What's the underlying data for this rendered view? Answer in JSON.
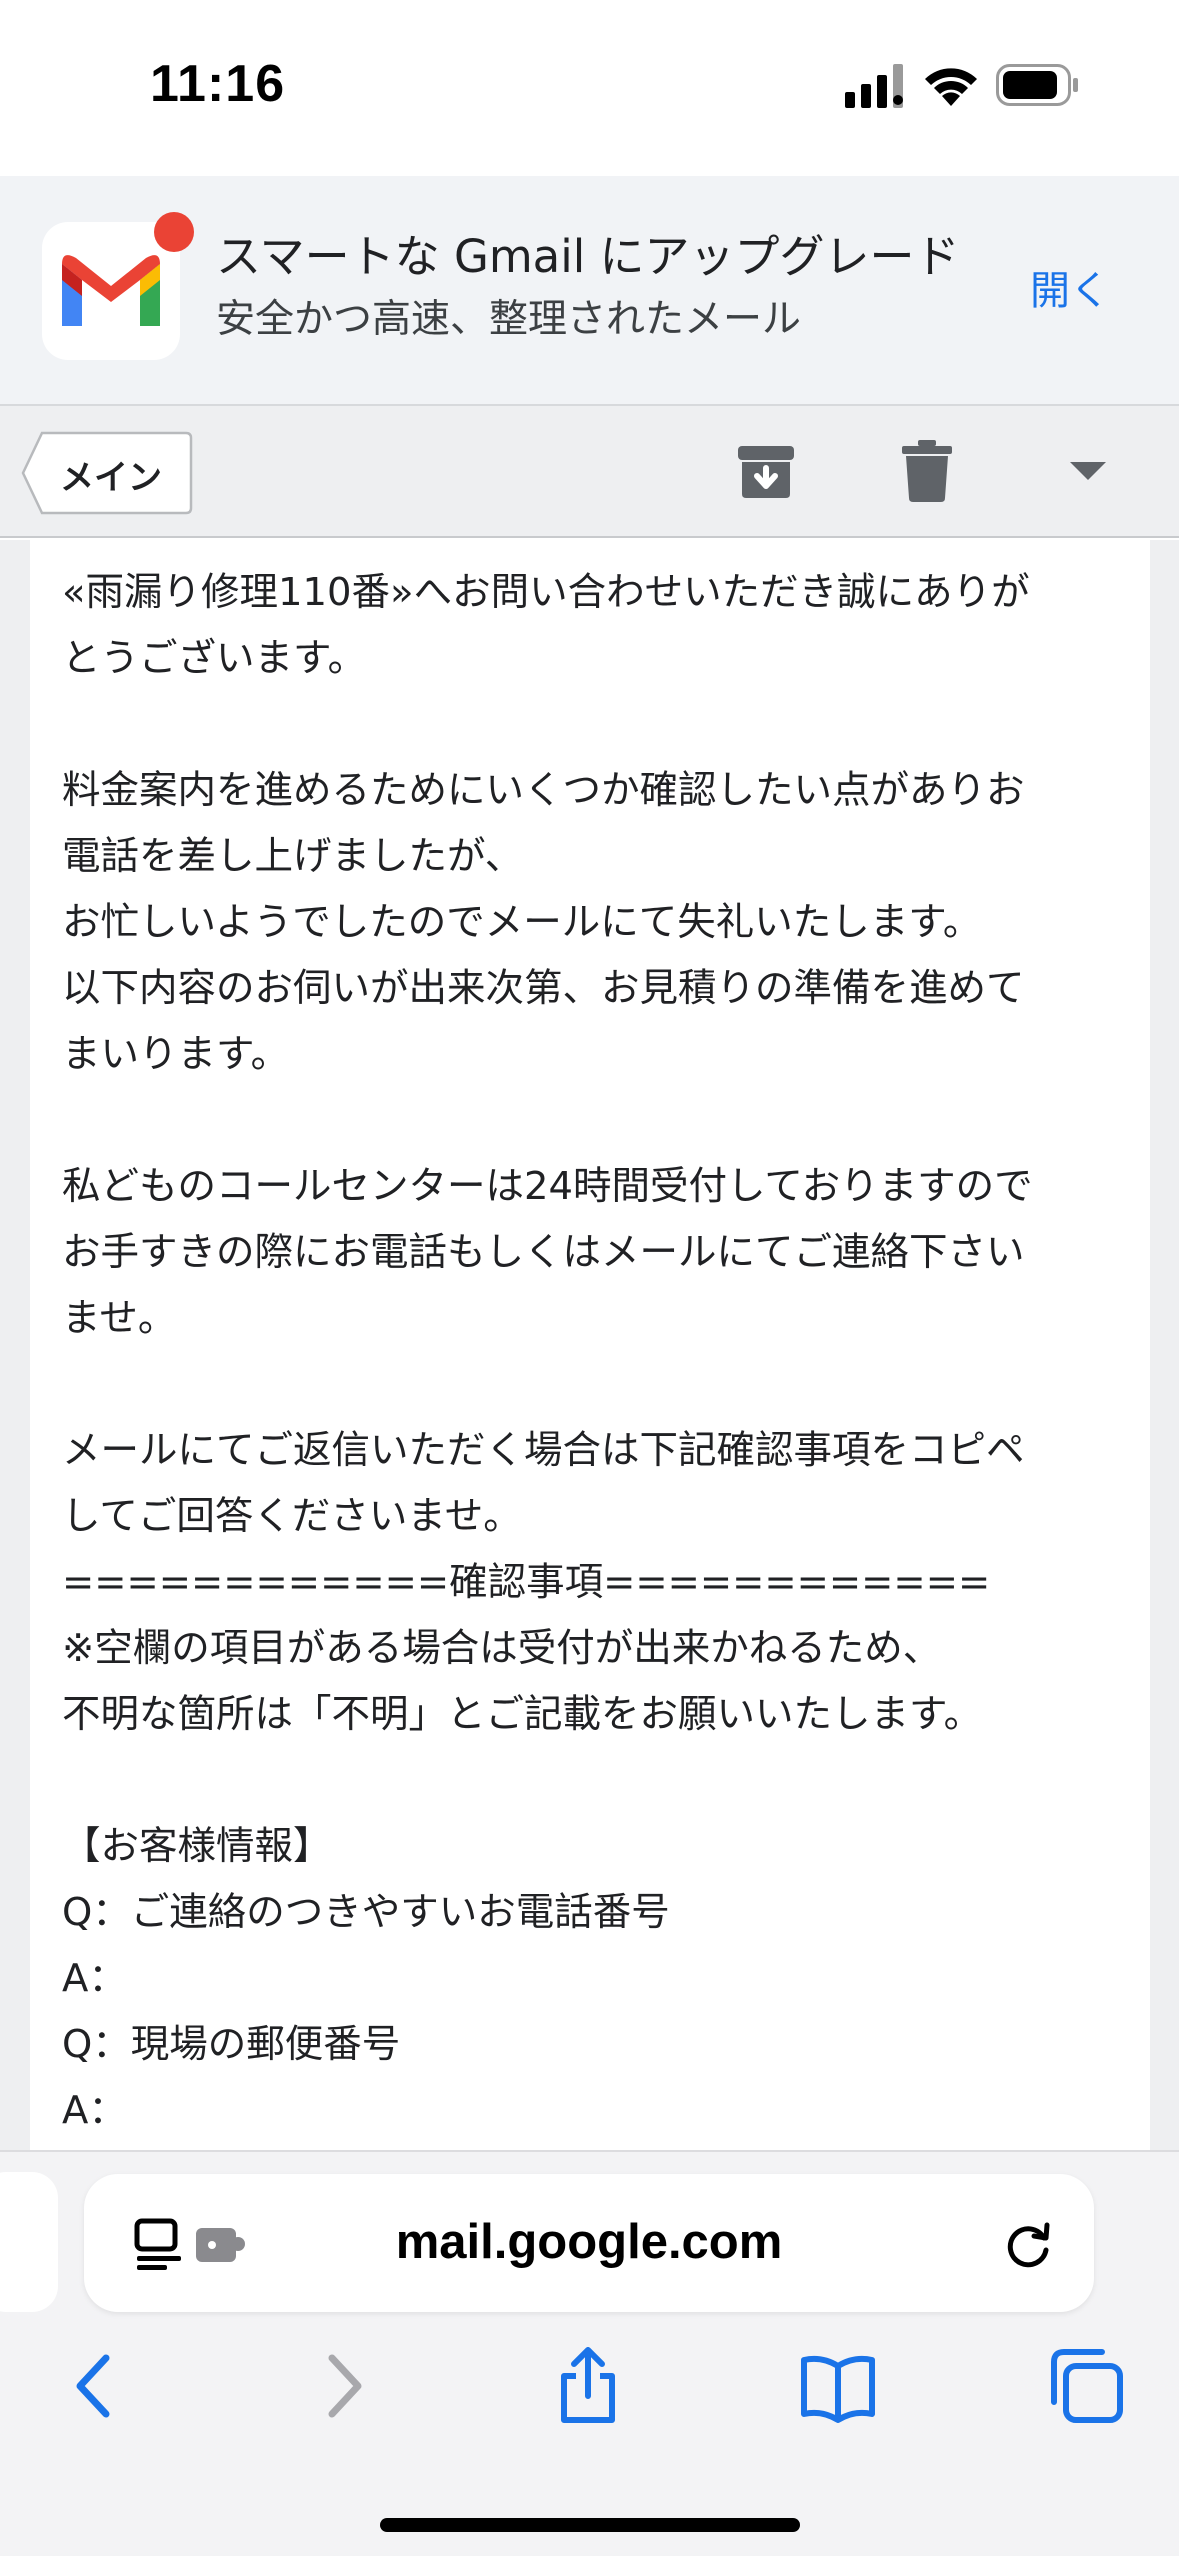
{
  "status_bar": {
    "time": "11:16",
    "icons": [
      "signal-icon",
      "wifi-icon",
      "battery-icon"
    ]
  },
  "promo": {
    "title": "スマートな Gmail にアップグレード",
    "subtitle": "安全かつ高速、整理されたメール",
    "open_label": "開く",
    "logo": "gmail-logo"
  },
  "toolbar": {
    "back_label": "メイン",
    "icons": [
      "archive-icon",
      "trash-icon",
      "chevron-down-icon"
    ]
  },
  "mail": {
    "lines": [
      "«雨漏り修理110番»へお問い合わせいただき誠にありが",
      "とうございます。",
      "",
      "料金案内を進めるためにいくつか確認したい点がありお",
      "電話を差し上げましたが、",
      "お忙しいようでしたのでメールにて失礼いたします。",
      "以下内容のお伺いが出来次第、お見積りの準備を進めて",
      "まいります。",
      "",
      "私どものコールセンターは24時間受付しておりますので",
      "お手すきの際にお電話もしくはメールにてご連絡下さい",
      "ませ。",
      "",
      "メールにてご返信いただく場合は下記確認事項をコピペ",
      "してご回答くださいませ。",
      "============確認事項============",
      "※空欄の項目がある場合は受付が出来かねるため、",
      "不明な箇所は「不明」とご記載をお願いいたします。",
      "",
      "【お客様情報】",
      "Q：ご連絡のつきやすいお電話番号",
      "A：",
      "Q：現場の郵便番号",
      "A："
    ]
  },
  "safari": {
    "url": "mail.google.com",
    "icons": [
      "reader-icon",
      "extension-icon",
      "reload-icon",
      "back-icon",
      "forward-icon",
      "share-icon",
      "bookmarks-icon",
      "tabs-icon"
    ],
    "accent_color": "#1a73e8"
  }
}
